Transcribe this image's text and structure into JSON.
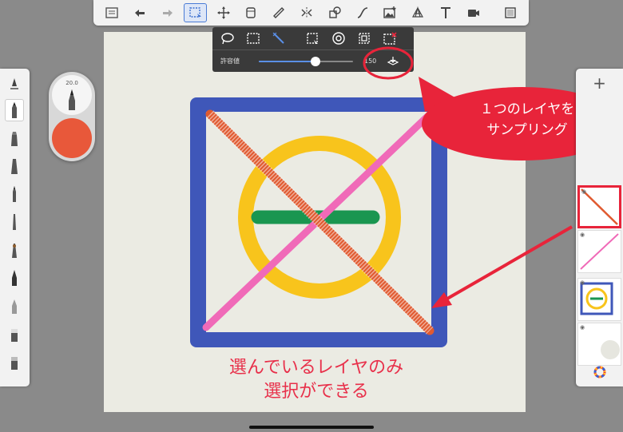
{
  "top_toolbar": {
    "tools": [
      "layers-icon",
      "undo-icon",
      "redo-icon",
      "selection-icon",
      "transform-icon",
      "layer-copy-icon",
      "ruler-icon",
      "symmetry-icon",
      "shape-icon",
      "curve-icon",
      "image-icon",
      "perspective-icon",
      "text-icon",
      "video-icon",
      "fullscreen-icon"
    ],
    "active_tool": "selection-icon"
  },
  "selection_toolbar": {
    "modes": [
      "lasso-select-icon",
      "rect-select-icon",
      "magic-wand-icon",
      "crop-icon",
      "target-icon",
      "fit-icon",
      "clear-select-icon"
    ],
    "active_mode": "magic-wand-icon",
    "tolerance_label": "許容値",
    "tolerance_value": "150",
    "tolerance_fraction": 0.6
  },
  "brush_puck": {
    "size_label": "20.0",
    "color": "#e8583a"
  },
  "callout": {
    "line1": "１つのレイヤを",
    "line2": "サンプリング"
  },
  "caption": {
    "line1": "選んでいるレイヤのみ",
    "line2": "選択ができる"
  },
  "colors": {
    "accent": "#4a7bd6",
    "annotation_red": "#e8243a",
    "frame_blue": "#3f57b9",
    "ring_yellow": "#f8c41c",
    "bar_green": "#1a9650",
    "line_pink": "#f06ab8",
    "line_orange": "#e05a30"
  }
}
